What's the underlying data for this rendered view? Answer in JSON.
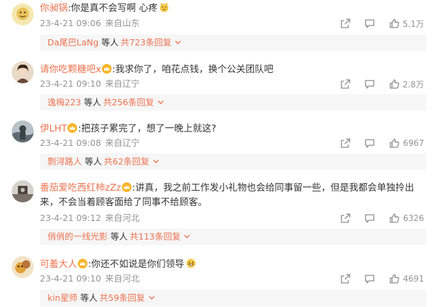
{
  "colors": {
    "accent": "#eb7350",
    "meta": "#939393",
    "reply_bg": "#f6f6f6"
  },
  "icons": {
    "forward": "forward-icon",
    "comment": "comment-icon",
    "like": "thumbs-up-icon",
    "vip": "crown-badge-icon",
    "reply_more": "chevron-down-icon"
  },
  "comments": [
    {
      "user": "你昶锅",
      "text": ":你是真不会写啊 心疼",
      "emoji": "smiling-cat-emoji",
      "time": "23-4-21 09:06",
      "location": "来自山东",
      "likes": "5.1万",
      "reply": {
        "user": "Da尾巴LaNg",
        "sep": "等人",
        "count": "共723条回复"
      }
    },
    {
      "user": "请你吃颗糖吧x",
      "text": ":我求你了，咱花点钱，换个公关团队吧",
      "time": "23-4-21 09:10",
      "location": "来自辽宁",
      "likes": "2.8万",
      "reply": {
        "user": "逸梅223",
        "sep": "等人",
        "count": "共256条回复"
      }
    },
    {
      "user": "伊LHT",
      "text": ":把孩子累完了，想了一晚上就这?",
      "time": "23-4-21 09:08",
      "location": "来自辽宁",
      "likes": "6967",
      "reply": {
        "user": "剽浔路人",
        "sep": "等人",
        "count": "共62条回复"
      }
    },
    {
      "user": "番茄爱吃西红柿zZz",
      "text": ":讲真，我之前工作发小礼物也会给同事留一些，但是我都会单独拎出来，不会当着顾客面给了同事不给顾客。",
      "time": "23-4-21 09:12",
      "location": "来自河北",
      "likes": "6326",
      "reply": {
        "user": "俏俏的一线光影",
        "sep": "等人",
        "count": "共113条回复"
      }
    },
    {
      "user": "可羞大人",
      "text": ":你还不如说是你们领导",
      "emoji": "grin-emoji",
      "time": "23-4-21 09:10",
      "location": "来自河北",
      "likes": "4691",
      "reply": {
        "user": "kin星师",
        "sep": "等人",
        "count": "共59条回复"
      }
    }
  ]
}
